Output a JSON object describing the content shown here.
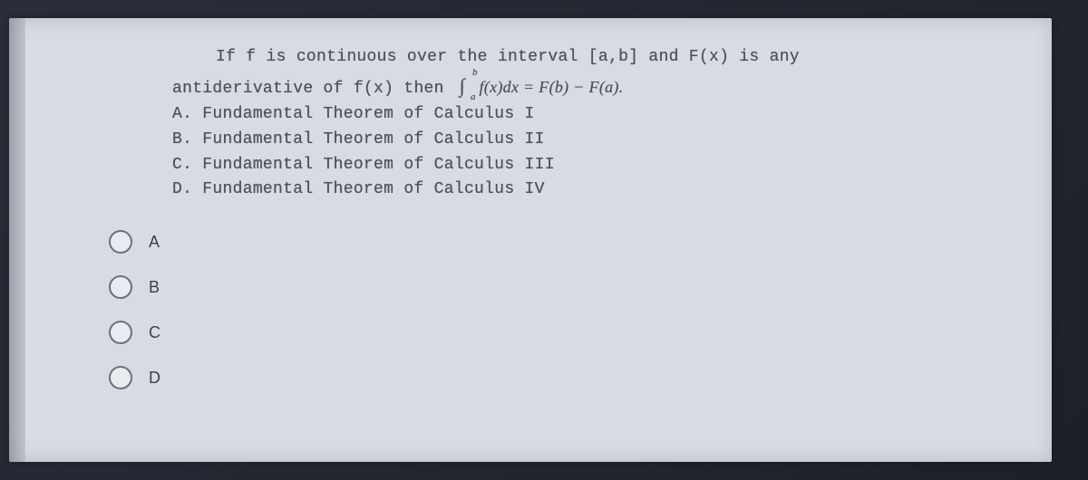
{
  "question": {
    "line1_prefix": "If f is continuous over the interval [a,b] and F(x) is any",
    "line2_prefix": "antiderivative of f(x) then ",
    "integral_lower": "a",
    "integral_upper": "b",
    "integrand": "f(x)dx",
    "equals": " = F(b) − F(a).",
    "stem_options": {
      "A": "A. Fundamental Theorem of Calculus I",
      "B": "B. Fundamental Theorem of Calculus II",
      "C": "C. Fundamental Theorem of Calculus III",
      "D": "D. Fundamental Theorem of Calculus IV"
    }
  },
  "choices": {
    "A": "A",
    "B": "B",
    "C": "C",
    "D": "D"
  }
}
